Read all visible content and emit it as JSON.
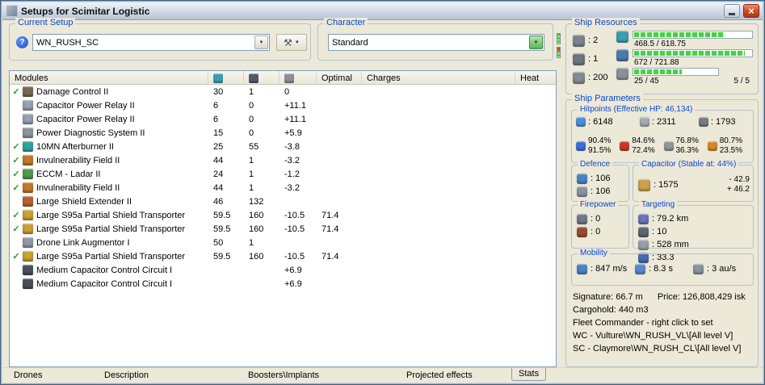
{
  "window": {
    "title": "Setups for Scimitar Logistic"
  },
  "controls": {
    "dropdown_glyph": "▼",
    "help_glyph": "?",
    "tools_glyph": "⚒",
    "close_glyph": "×",
    "check_glyph": "✓"
  },
  "theme": {
    "window_bg": "#ece9d8",
    "legend_blue": "#0a46d0",
    "check_green": "#22a322",
    "bar_green": "#44d344",
    "close_red": "#d6502e"
  },
  "current_setup": {
    "label": "Current Setup",
    "value": "WN_RUSH_SC"
  },
  "character": {
    "label": "Character",
    "value": "Standard"
  },
  "ship_resources": {
    "title": "Ship Resources",
    "slots": [
      {
        "icon": "turret-hardpoints-icon",
        "color": "#7d838c",
        "value": ": 2"
      },
      {
        "icon": "launcher-hardpoints-icon",
        "color": "#6f7680",
        "value": ": 1"
      },
      {
        "icon": "calibration-icon",
        "color": "#848a93",
        "value": ": 200"
      }
    ],
    "cpu": {
      "color": "#3a9fae",
      "value": "468.5 / 618.75",
      "pct": 76
    },
    "powergrid": {
      "color": "#4a7ab0",
      "value": "672 / 721.88",
      "pct": 93
    },
    "drones": {
      "color": "#8a9098",
      "value": "25 / 45",
      "pct": 56,
      "extra": "5 / 5"
    }
  },
  "modules": {
    "columns": {
      "name": "Modules",
      "optimal": "Optimal",
      "charges": "Charges",
      "heat": "Heat",
      "cpu_icon_color": "#3a9fae",
      "pg_icon_color": "#50586a",
      "cap_icon_color": "#8a8f98"
    },
    "rows": [
      {
        "active": true,
        "icon_color": "#7a6a4f",
        "name": "Damage Control II",
        "cpu": "30",
        "pg": "1",
        "cap": "0",
        "optimal": ""
      },
      {
        "active": false,
        "icon_color": "#98a0b4",
        "name": "Capacitor Power Relay II",
        "cpu": "6",
        "pg": "0",
        "cap": "+11.1",
        "optimal": ""
      },
      {
        "active": false,
        "icon_color": "#98a0b4",
        "name": "Capacitor Power Relay II",
        "cpu": "6",
        "pg": "0",
        "cap": "+11.1",
        "optimal": ""
      },
      {
        "active": false,
        "icon_color": "#8f959d",
        "name": "Power Diagnostic System II",
        "cpu": "15",
        "pg": "0",
        "cap": "+5.9",
        "optimal": ""
      },
      {
        "active": true,
        "icon_color": "#2fa3a0",
        "name": "10MN Afterburner II",
        "cpu": "25",
        "pg": "55",
        "cap": "-3.8",
        "optimal": ""
      },
      {
        "active": true,
        "icon_color": "#c07a2a",
        "name": "Invulnerability Field II",
        "cpu": "44",
        "pg": "1",
        "cap": "-3.2",
        "optimal": ""
      },
      {
        "active": true,
        "icon_color": "#4f9a4f",
        "name": "ECCM - Ladar II",
        "cpu": "24",
        "pg": "1",
        "cap": "-1.2",
        "optimal": ""
      },
      {
        "active": true,
        "icon_color": "#c07a2a",
        "name": "Invulnerability Field II",
        "cpu": "44",
        "pg": "1",
        "cap": "-3.2",
        "optimal": ""
      },
      {
        "active": false,
        "icon_color": "#b8622f",
        "name": "Large Shield Extender II",
        "cpu": "46",
        "pg": "132",
        "cap": "",
        "optimal": ""
      },
      {
        "active": true,
        "icon_color": "#c9a232",
        "name": "Large S95a Partial Shield Transporter",
        "cpu": "59.5",
        "pg": "160",
        "cap": "-10.5",
        "optimal": "71.4"
      },
      {
        "active": true,
        "icon_color": "#c9a232",
        "name": "Large S95a Partial Shield Transporter",
        "cpu": "59.5",
        "pg": "160",
        "cap": "-10.5",
        "optimal": "71.4"
      },
      {
        "active": false,
        "icon_color": "#929aa8",
        "name": "Drone Link Augmentor I",
        "cpu": "50",
        "pg": "1",
        "cap": "",
        "optimal": ""
      },
      {
        "active": true,
        "icon_color": "#c9a232",
        "name": "Large S95a Partial Shield Transporter",
        "cpu": "59.5",
        "pg": "160",
        "cap": "-10.5",
        "optimal": "71.4"
      },
      {
        "active": false,
        "icon_color": "#4a505a",
        "name": "Medium Capacitor Control Circuit I",
        "cpu": "",
        "pg": "",
        "cap": "+6.9",
        "optimal": ""
      },
      {
        "active": false,
        "icon_color": "#4a505a",
        "name": "Medium Capacitor Control Circuit I",
        "cpu": "",
        "pg": "",
        "cap": "+6.9",
        "optimal": ""
      }
    ]
  },
  "ship_parameters": {
    "title": "Ship Parameters",
    "hitpoints": {
      "title": "Hitpoints (Effective HP: 46,134)",
      "pools": [
        {
          "icon": "shield-hp-icon",
          "color": "#4a90d8",
          "value": ": 6148"
        },
        {
          "icon": "armor-hp-icon",
          "color": "#a8adb5",
          "value": ": 2311"
        },
        {
          "icon": "structure-hp-icon",
          "color": "#787d84",
          "value": ": 1793"
        }
      ],
      "resists": [
        {
          "icon": "em-resist-icon",
          "color": "#3a6fd8",
          "shield": "90.4%",
          "armor": "91.5%"
        },
        {
          "icon": "thermal-resist-icon",
          "color": "#c83a28",
          "shield": "84.6%",
          "armor": "72.4%"
        },
        {
          "icon": "kinetic-resist-icon",
          "color": "#9198a2",
          "shield": "76.8%",
          "armor": "36.3%"
        },
        {
          "icon": "explosive-resist-icon",
          "color": "#d8892a",
          "shield": "80.7%",
          "armor": "23.5%"
        }
      ]
    },
    "defence": {
      "title": "Defence",
      "rows": [
        {
          "icon": "shield-recharge-icon",
          "color": "#4a84c4",
          "value": ": 106"
        },
        {
          "icon": "sustained-defence-icon",
          "color": "#8a93a0",
          "value": ": 106"
        }
      ]
    },
    "capacitor": {
      "title": "Capacitor (Stable at: 44%)",
      "icon_color": "#c8a24a",
      "amount": ": 1575",
      "usage": "- 42.9",
      "recharge": "+ 46.2"
    },
    "firepower": {
      "title": "Firepower",
      "rows": [
        {
          "icon": "turret-damage-icon",
          "color": "#707a86",
          "value": ": 0"
        },
        {
          "icon": "missile-damage-icon",
          "color": "#9a4a30",
          "value": ": 0"
        }
      ]
    },
    "targeting": {
      "title": "Targeting",
      "cells": [
        {
          "icon": "targeting-range-icon",
          "color": "#6a74b8",
          "value": ": 79.2 km"
        },
        {
          "icon": "max-targets-icon",
          "color": "#5f666e",
          "value": ": 10"
        },
        {
          "icon": "scan-resolution-icon",
          "color": "#9aa0a8",
          "value": ": 528 mm"
        },
        {
          "icon": "sensor-strength-icon",
          "color": "#4a6ab0",
          "value": ": 33.3"
        }
      ]
    },
    "mobility": {
      "title": "Mobility",
      "cells": [
        {
          "icon": "max-velocity-icon",
          "color": "#4a84c4",
          "value": ": 847 m/s"
        },
        {
          "icon": "align-time-icon",
          "color": "#5a8ac8",
          "value": ": 8.3 s"
        },
        {
          "icon": "warp-speed-icon",
          "color": "#8a93a0",
          "value": ": 3 au/s"
        }
      ]
    },
    "summary": {
      "signature": "Signature: 66.7 m",
      "price": "Price: 126,808,429 isk",
      "cargohold": "Cargohold: 440 m3",
      "fleet_commander": "Fleet Commander - right click to set",
      "wing_commander": "WC - Vulture\\WN_RUSH_VL\\[All level V]",
      "squad_commander": "SC - Claymore\\WN_RUSH_CL\\[All level V]"
    }
  },
  "footer_tabs": [
    {
      "label": "Drones",
      "active": false
    },
    {
      "label": "Description",
      "active": false
    },
    {
      "label": "Boosters\\Implants",
      "active": false
    },
    {
      "label": "Projected effects",
      "active": false
    },
    {
      "label": "Stats",
      "active": true
    }
  ]
}
